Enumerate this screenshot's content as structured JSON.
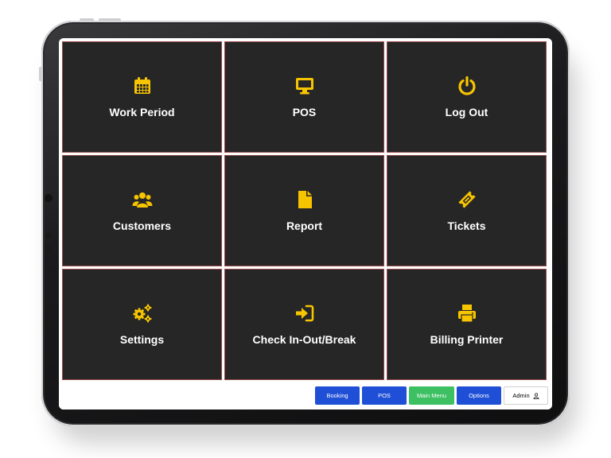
{
  "tiles": [
    {
      "label": "Work Period",
      "icon": "calendar-icon"
    },
    {
      "label": "POS",
      "icon": "monitor-icon"
    },
    {
      "label": "Log Out",
      "icon": "power-icon"
    },
    {
      "label": "Customers",
      "icon": "users-icon"
    },
    {
      "label": "Report",
      "icon": "file-icon"
    },
    {
      "label": "Tickets",
      "icon": "ticket-icon"
    },
    {
      "label": "Settings",
      "icon": "gears-icon"
    },
    {
      "label": "Check In-Out/Break",
      "icon": "sign-in-icon"
    },
    {
      "label": "Billing Printer",
      "icon": "printer-icon"
    }
  ],
  "bottom_bar": {
    "booking": "Booking",
    "pos": "POS",
    "main_menu": "Main Menu",
    "options": "Options",
    "admin": "Admin",
    "admin_icon": "user-icon"
  },
  "colors": {
    "tile_bg": "#262626",
    "icon": "#f7c400",
    "button_blue": "#1f4fd6",
    "button_green": "#3cc062"
  }
}
